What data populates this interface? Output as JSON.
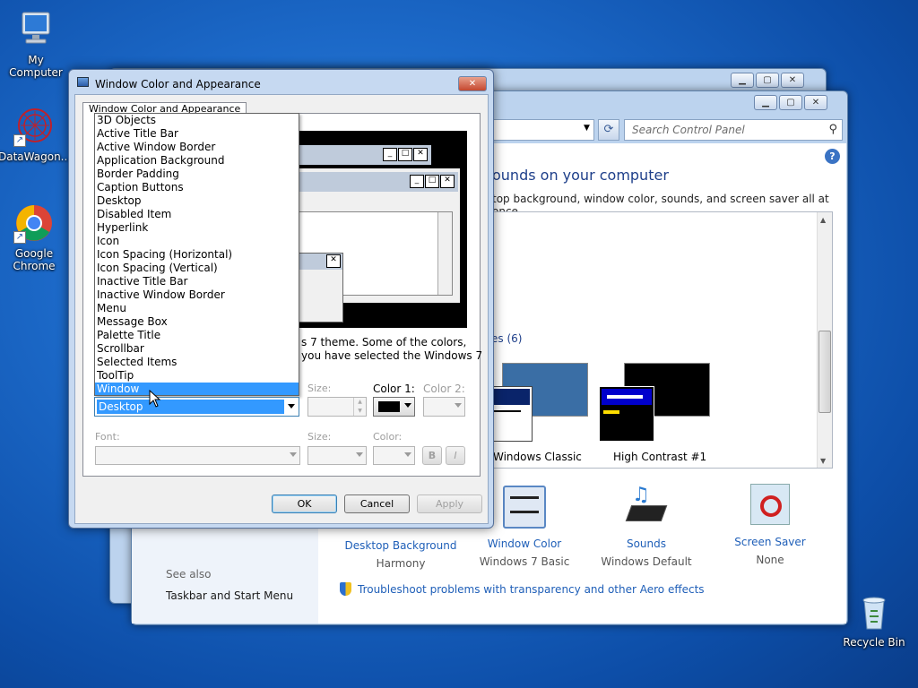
{
  "desktop": {
    "icons": [
      {
        "label": "My Computer"
      },
      {
        "label": "DataWagon..."
      },
      {
        "label": "Google Chrome"
      },
      {
        "label": "Recycle Bin"
      }
    ]
  },
  "control_panel": {
    "search_placeholder": "Search Control Panel",
    "heading": "ounds on your computer",
    "description": "top background, window color, sounds, and screen saver all at once.",
    "section_label": "es (6)",
    "themes": [
      {
        "label": "Windows Classic"
      },
      {
        "label": "High Contrast #1"
      }
    ],
    "bottom_items": [
      {
        "title": "Desktop Background",
        "value": "Harmony"
      },
      {
        "title": "Window Color",
        "value": "Windows 7 Basic"
      },
      {
        "title": "Sounds",
        "value": "Windows Default"
      },
      {
        "title": "Screen Saver",
        "value": "None"
      }
    ],
    "see_also": "See also",
    "taskbar_link": "Taskbar and Start Menu",
    "troubleshoot_link": "Troubleshoot problems with transparency and other Aero effects"
  },
  "dialog": {
    "title": "Window Color and Appearance",
    "tab": "Window Color and Appearance",
    "note_line1": "s 7 theme.  Some of the colors,",
    "note_line2": "you have selected the Windows 7",
    "item_list": [
      "3D Objects",
      "Active Title Bar",
      "Active Window Border",
      "Application Background",
      "Border Padding",
      "Caption Buttons",
      "Desktop",
      "Disabled Item",
      "Hyperlink",
      "Icon",
      "Icon Spacing (Horizontal)",
      "Icon Spacing (Vertical)",
      "Inactive Title Bar",
      "Inactive Window Border",
      "Menu",
      "Message Box",
      "Palette Title",
      "Scrollbar",
      "Selected Items",
      "ToolTip",
      "Window"
    ],
    "selected_index": 20,
    "item_value": "Desktop",
    "size_label": "Size:",
    "color1_label": "Color 1:",
    "color2_label": "Color 2:",
    "font_label": "Font:",
    "font_size_label": "Size:",
    "font_color_label": "Color:",
    "bold": "B",
    "italic": "I",
    "ok": "OK",
    "cancel": "Cancel",
    "apply": "Apply",
    "color1_value": "#000000"
  }
}
